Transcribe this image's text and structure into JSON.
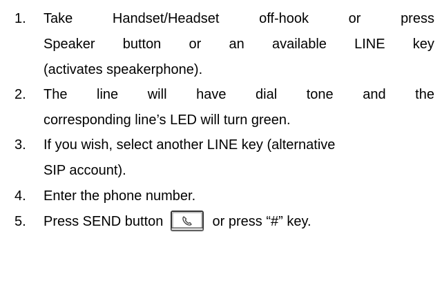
{
  "steps": [
    {
      "number": "1.",
      "line1_words": [
        "Take",
        "Handset/Headset",
        "off-hook",
        "or",
        "press"
      ],
      "line2_words": [
        "Speaker",
        "button",
        "or",
        "an",
        "available",
        "LINE",
        "key"
      ],
      "line3": "(activates speakerphone)."
    },
    {
      "number": "2.",
      "line1_words": [
        "The",
        "line",
        "will",
        "have",
        "dial",
        "tone",
        "and",
        "the"
      ],
      "line2": "corresponding line’s LED will turn green."
    },
    {
      "number": "3.",
      "line1": "If you wish, select another LINE key (alternative",
      "line2": "SIP account)."
    },
    {
      "number": "4.",
      "line1": "Enter the phone number."
    },
    {
      "number": "5.",
      "text_before": "Press SEND button",
      "text_after": "or press “#” key.",
      "icon": "handset-send-icon"
    }
  ]
}
